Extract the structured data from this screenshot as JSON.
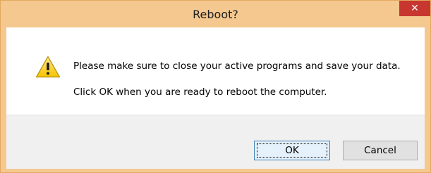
{
  "window": {
    "title": "Reboot?",
    "close_glyph": "✕",
    "accent_color": "#f4c88f",
    "close_color": "#c7372f"
  },
  "message": {
    "line1": "Please make sure to close your active programs and save your data.",
    "line2": "Click OK when you are ready to reboot the computer.",
    "icon": "warning-icon"
  },
  "buttons": {
    "ok_label": "OK",
    "cancel_label": "Cancel"
  }
}
